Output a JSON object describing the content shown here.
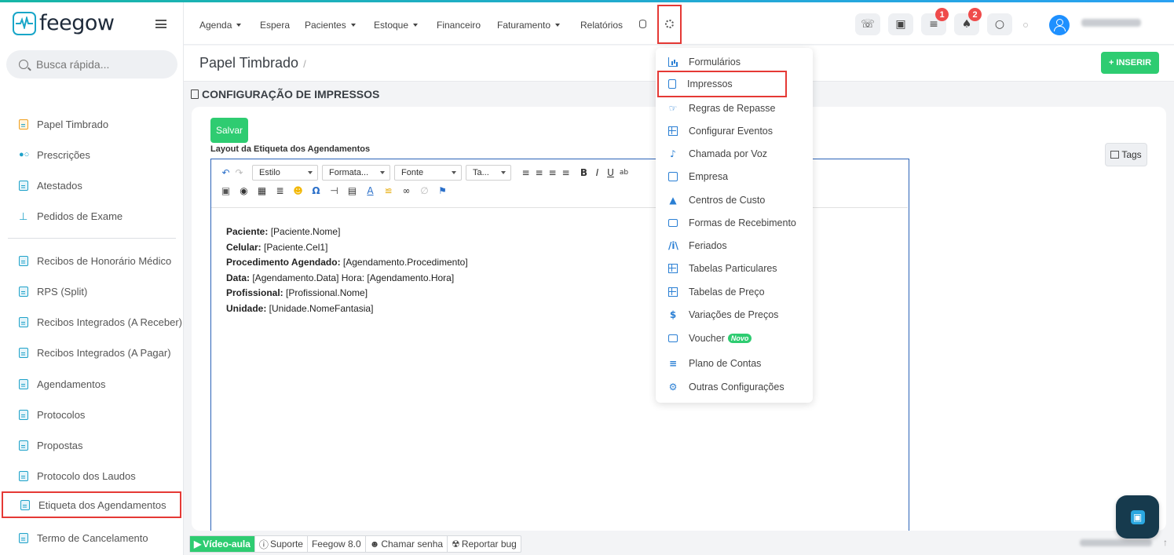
{
  "app": {
    "brand": "feegow"
  },
  "sidebar": {
    "search_placeholder": "Busca rápida...",
    "items": [
      {
        "label": "Papel Timbrado"
      },
      {
        "label": "Prescrições"
      },
      {
        "label": "Atestados"
      },
      {
        "label": "Pedidos de Exame"
      },
      {
        "label": "Recibos de Honorário Médico"
      },
      {
        "label": "RPS (Split)"
      },
      {
        "label": "Recibos Integrados (A Receber)"
      },
      {
        "label": "Recibos Integrados (A Pagar)"
      },
      {
        "label": "Agendamentos"
      },
      {
        "label": "Protocolos"
      },
      {
        "label": "Propostas"
      },
      {
        "label": "Protocolo dos Laudos"
      },
      {
        "label": "Etiqueta dos Agendamentos"
      },
      {
        "label": "Termo de Cancelamento"
      }
    ]
  },
  "nav": {
    "items": [
      {
        "label": "Agenda"
      },
      {
        "label": "Espera"
      },
      {
        "label": "Pacientes"
      },
      {
        "label": "Estoque"
      },
      {
        "label": "Financeiro"
      },
      {
        "label": "Faturamento"
      },
      {
        "label": "Relatórios"
      }
    ],
    "badges": {
      "tasks": "1",
      "notifications": "2"
    }
  },
  "header": {
    "title": "Papel Timbrado",
    "separator": "/",
    "insert_label": "+ INSERIR"
  },
  "section": {
    "title": "CONFIGURAÇÃO DE IMPRESSOS"
  },
  "editor": {
    "save_label": "Salvar",
    "label": "Layout da Etiqueta dos Agendamentos",
    "tags_label": "Tags",
    "selects": {
      "style": "Estilo",
      "format": "Formata...",
      "font": "Fonte",
      "size": "Ta..."
    },
    "content": [
      {
        "key": "Paciente:",
        "value": " [Paciente.Nome]"
      },
      {
        "key": "Celular:",
        "value": " [Paciente.Cel1]"
      },
      {
        "key": "Procedimento Agendado:",
        "value": " [Agendamento.Procedimento]"
      },
      {
        "key": "Data:",
        "value": " [Agendamento.Data] Hora: [Agendamento.Hora]"
      },
      {
        "key": "Profissional:",
        "value": " [Profissional.Nome]"
      },
      {
        "key": "Unidade:",
        "value": " [Unidade.NomeFantasia]"
      }
    ]
  },
  "dropdown": {
    "items": [
      {
        "label": "Formulários"
      },
      {
        "label": "Impressos"
      },
      {
        "label": "Regras de Repasse"
      },
      {
        "label": "Configurar Eventos"
      },
      {
        "label": "Chamada por Voz"
      },
      {
        "label": "Empresa"
      },
      {
        "label": "Centros de Custo"
      },
      {
        "label": "Formas de Recebimento"
      },
      {
        "label": "Feriados"
      },
      {
        "label": "Tabelas Particulares"
      },
      {
        "label": "Tabelas de Preço"
      },
      {
        "label": "Variações de Preços"
      },
      {
        "label": "Voucher",
        "badge": "Novo"
      },
      {
        "label": "Plano de Contas"
      },
      {
        "label": "Outras Configurações"
      }
    ]
  },
  "footer": {
    "video": "Vídeo-aula",
    "support": "Suporte",
    "version": "Feegow 8.0",
    "call": "Chamar senha",
    "bug": "Reportar bug"
  },
  "colors": {
    "accent": "#2ecc71",
    "brand": "#19a6c8",
    "highlight": "#e53935",
    "link": "#2a7fd4"
  }
}
